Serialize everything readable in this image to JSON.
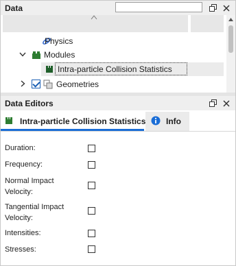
{
  "data_panel": {
    "title": "Data",
    "search_placeholder": "",
    "tree": [
      {
        "label": "Physics",
        "icon": "physics-icon"
      },
      {
        "label": "Modules",
        "icon": "modules-icon",
        "expanded": true
      },
      {
        "label": "Intra-particle Collision Statistics",
        "icon": "module-item-icon",
        "selected": true
      },
      {
        "label": "Geometries",
        "icon": "geometries-icon",
        "expanded": false,
        "checked": true
      }
    ]
  },
  "data_editors": {
    "title": "Data Editors",
    "tabs": [
      {
        "label": "Intra-particle Collision Statistics",
        "active": true
      },
      {
        "label": "Info",
        "active": false
      }
    ],
    "fields": [
      {
        "label": "Duration:",
        "checked": false
      },
      {
        "label": "Frequency:",
        "checked": false
      },
      {
        "label_lines": [
          "Normal Impact",
          "Velocity:"
        ],
        "checked": false
      },
      {
        "label_lines": [
          "Tangential Impact",
          "Velocity:"
        ],
        "checked": false
      },
      {
        "label": "Intensities:",
        "checked": false
      },
      {
        "label": "Stresses:",
        "checked": false
      }
    ]
  },
  "colors": {
    "accent": "#1a6dd6",
    "module_green": "#2e7d32",
    "header_bg": "#efefef"
  }
}
